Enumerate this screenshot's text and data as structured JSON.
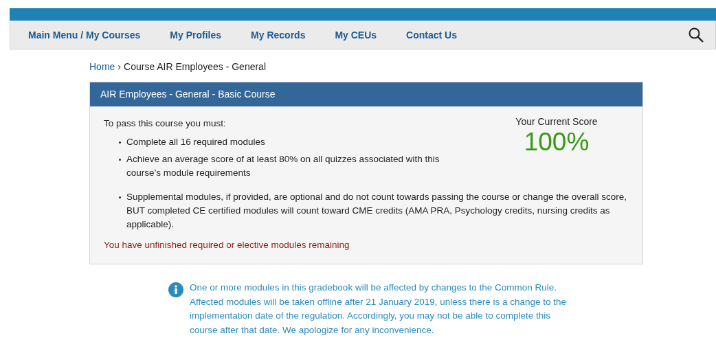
{
  "nav": {
    "items": [
      {
        "label": "Main Menu / My Courses"
      },
      {
        "label": "My Profiles"
      },
      {
        "label": "My Records"
      },
      {
        "label": "My CEUs"
      },
      {
        "label": "Contact Us"
      }
    ]
  },
  "breadcrumb": {
    "link": "Home",
    "separator": "›",
    "current": "Course AIR Employees - General"
  },
  "course": {
    "title": "AIR Employees - General - Basic Course",
    "intro": "To pass this course you must:",
    "requirements": [
      "Complete all 16 required modules",
      "Achieve an average score of at least 80% on all quizzes associated with this course’s module requirements",
      "Supplemental modules, if provided, are optional and do not count towards passing the course or change the overall score, BUT completed CE certified modules will count toward CME credits (AMA PRA, Psychology credits, nursing credits as applicable)."
    ],
    "warning": "You have unfinished required or elective modules remaining",
    "score_label": "Your Current Score",
    "score": "100%"
  },
  "notice": "One or more modules in this gradebook will be affected by changes to the Common Rule. Affected modules will be taken offline after 21 January 2019, unless there is a change to the implementation date of the regulation. Accordingly, you may not be able to complete this course after that date. We apologize for any inconvenience."
}
